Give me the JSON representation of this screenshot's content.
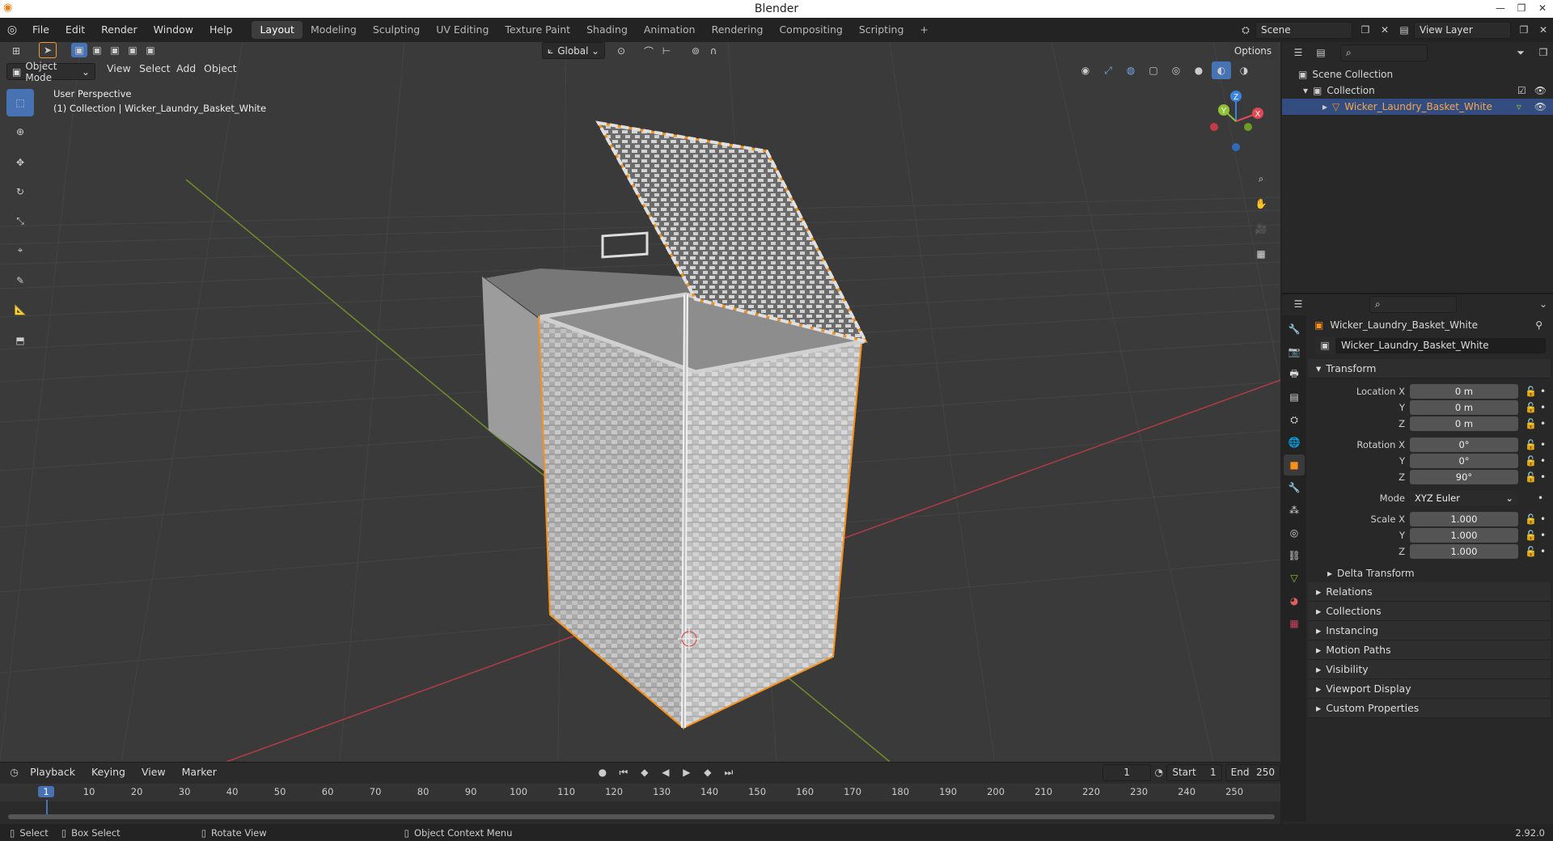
{
  "window": {
    "title": "Blender"
  },
  "topbar": {
    "menus": [
      "File",
      "Edit",
      "Render",
      "Window",
      "Help"
    ],
    "workspaces": [
      "Layout",
      "Modeling",
      "Sculpting",
      "UV Editing",
      "Texture Paint",
      "Shading",
      "Animation",
      "Rendering",
      "Compositing",
      "Scripting"
    ],
    "add_tab": "+",
    "scene": "Scene",
    "view_layer": "View Layer"
  },
  "viewport": {
    "mode": "Object Mode",
    "menus": [
      "View",
      "Select",
      "Add",
      "Object"
    ],
    "orientation": "Global",
    "options_label": "Options",
    "perspective": "User Perspective",
    "collection_info": "(1) Collection | Wicker_Laundry_Basket_White",
    "gizmo": {
      "x": "X",
      "y": "Y",
      "z": "Z"
    }
  },
  "outliner": {
    "scene_collection": "Scene Collection",
    "collection": "Collection",
    "object": "Wicker_Laundry_Basket_White"
  },
  "properties": {
    "object_name": "Wicker_Laundry_Basket_White",
    "data_name": "Wicker_Laundry_Basket_White",
    "transform_header": "Transform",
    "location_label": "Location X",
    "rotation_label": "Rotation X",
    "scale_label": "Scale X",
    "y_label": "Y",
    "z_label": "Z",
    "mode_label": "Mode",
    "location": {
      "x": "0 m",
      "y": "0 m",
      "z": "0 m"
    },
    "rotation": {
      "x": "0°",
      "y": "0°",
      "z": "90°"
    },
    "rotation_mode": "XYZ Euler",
    "scale": {
      "x": "1.000",
      "y": "1.000",
      "z": "1.000"
    },
    "delta_transform": "Delta Transform",
    "panels": [
      "Relations",
      "Collections",
      "Instancing",
      "Motion Paths",
      "Visibility",
      "Viewport Display",
      "Custom Properties"
    ]
  },
  "timeline": {
    "menus": [
      "Playback",
      "Keying",
      "View",
      "Marker"
    ],
    "current_frame": "1",
    "start_label": "Start",
    "start": "1",
    "end_label": "End",
    "end": "250",
    "ruler": [
      "1",
      "10",
      "20",
      "30",
      "40",
      "50",
      "60",
      "70",
      "80",
      "90",
      "100",
      "110",
      "120",
      "130",
      "140",
      "150",
      "160",
      "170",
      "180",
      "190",
      "200",
      "210",
      "220",
      "230",
      "240",
      "250"
    ]
  },
  "statusbar": {
    "select": "Select",
    "box_select": "Box Select",
    "rotate_view": "Rotate View",
    "context_menu": "Object Context Menu",
    "version": "2.92.0"
  },
  "colors": {
    "accent": "#4772b3",
    "selection": "#f7911c",
    "x_axis": "#e04a55",
    "y_axis": "#8fc335",
    "z_axis": "#3a84e0"
  }
}
